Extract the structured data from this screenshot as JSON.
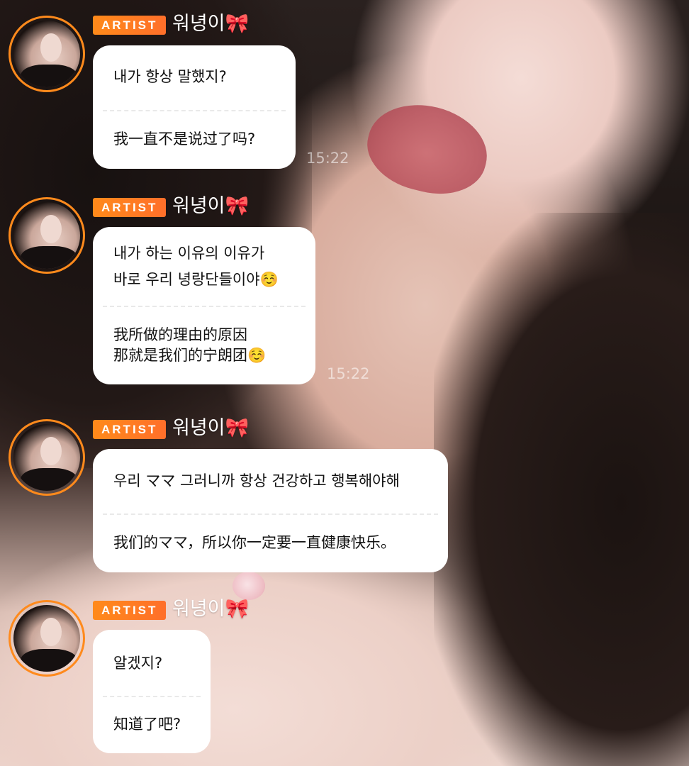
{
  "messages": [
    {
      "badge": "ARTIST",
      "name": "워녕이🎀",
      "original": [
        "내가 항상 말했지?"
      ],
      "translation": [
        "我一直不是说过了吗?"
      ],
      "time": "15:22"
    },
    {
      "badge": "ARTIST",
      "name": "워녕이🎀",
      "original": [
        "내가 하는 이유의 이유가",
        "바로 우리 녕랑단들이야☺️"
      ],
      "translation": [
        "我所做的理由的原因",
        "那就是我们的宁朗团☺️"
      ],
      "time": "15:22"
    },
    {
      "badge": "ARTIST",
      "name": "워녕이🎀",
      "original": [
        "우리 ママ 그러니까 항상 건강하고 행복해야해"
      ],
      "translation": [
        "我们的ママ，所以你一定要一直健康快乐。"
      ]
    },
    {
      "badge": "ARTIST",
      "name": "워녕이🎀",
      "original": [
        "알겠지?"
      ],
      "translation": [
        "知道了吧?"
      ]
    }
  ],
  "colors": {
    "badge": "#ff7a22",
    "avatar_ring": "#ff8a1c",
    "bubble": "#ffffff"
  }
}
